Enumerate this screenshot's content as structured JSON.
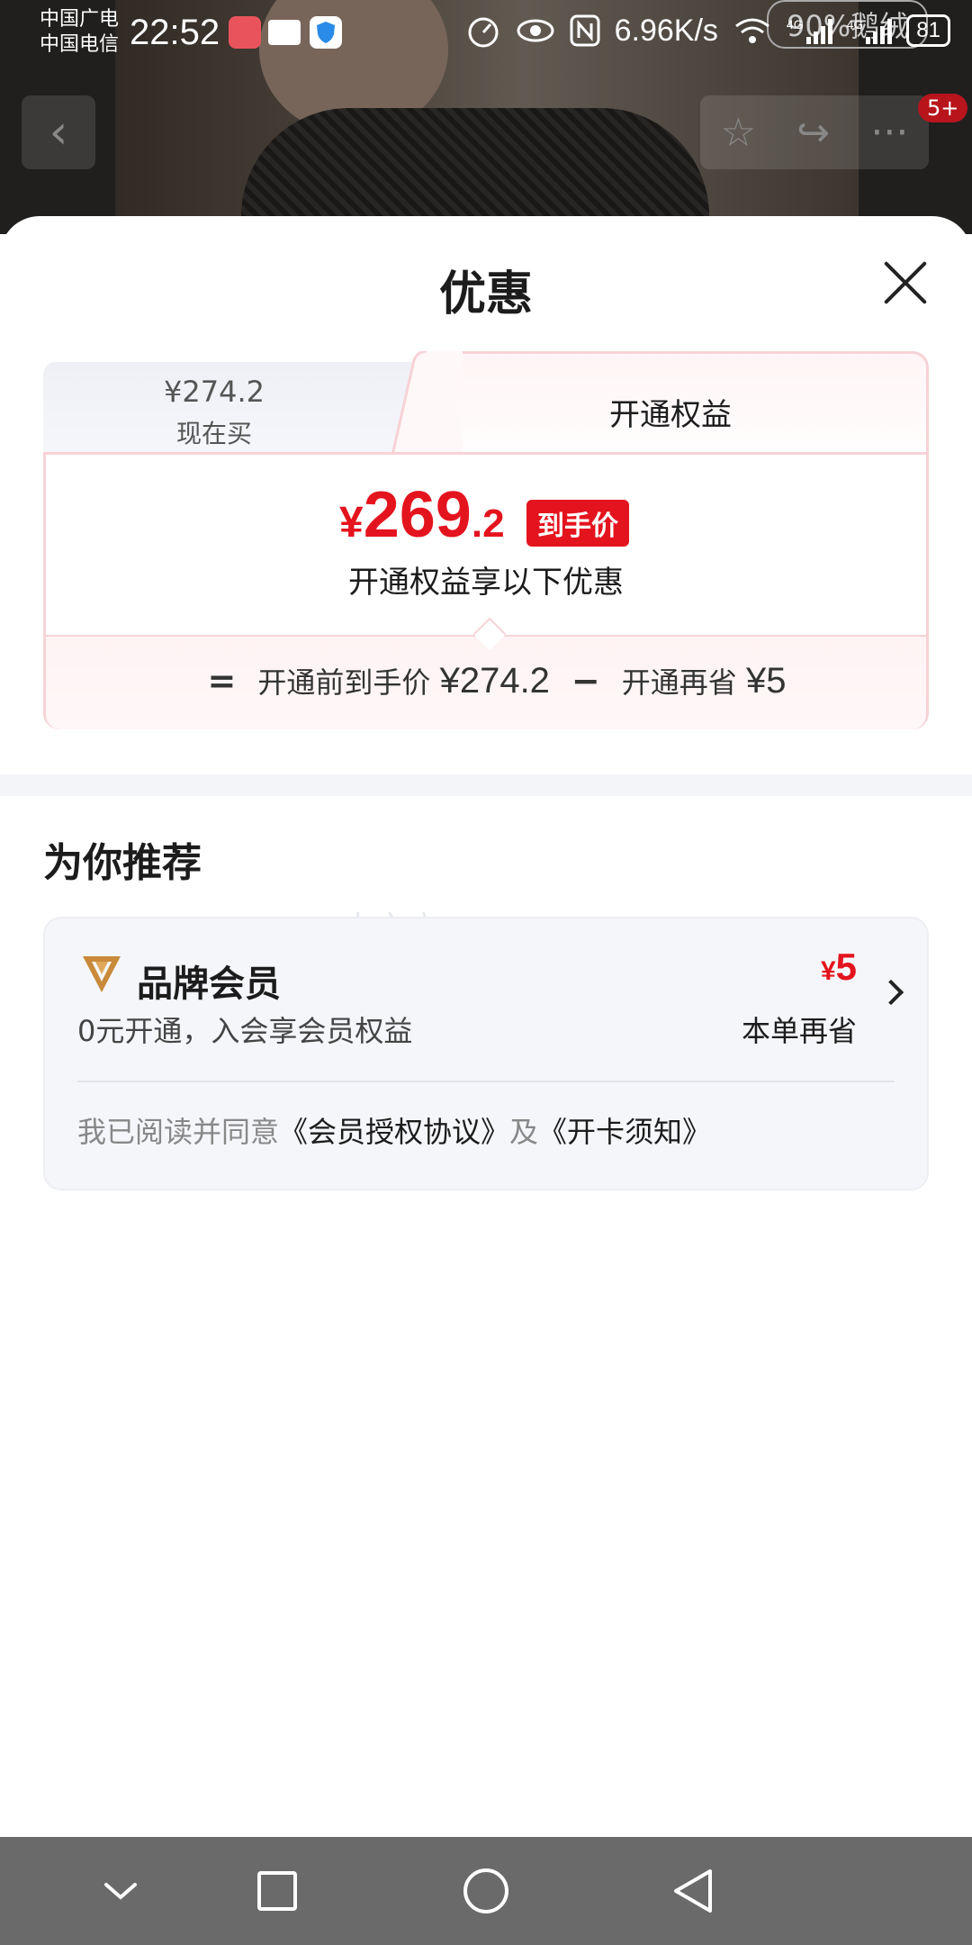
{
  "status_bar": {
    "carrier1": "中国广电",
    "carrier2": "中国电信",
    "time": "22:52",
    "speed": "6.96K/s",
    "network1": "4G",
    "network2": "4G",
    "battery": "81"
  },
  "background": {
    "badge": "5+",
    "tag": "90%鹅绒"
  },
  "sheet": {
    "title": "优惠",
    "tabs": {
      "left_price": "¥274.2",
      "left_label": "现在买",
      "right_label": "开通权益"
    },
    "final_price": {
      "currency": "¥",
      "integer": "269",
      "decimal": ".2",
      "badge": "到手价",
      "desc": "开通权益享以下优惠"
    },
    "formula": {
      "eq": "=",
      "before_label": "开通前到手价",
      "before_value": "¥274.2",
      "minus": "−",
      "save_label": "开通再省",
      "save_value": "¥5"
    }
  },
  "recommend": {
    "title": "为你推荐",
    "watermark": "电之广二",
    "card": {
      "name": "品牌会员",
      "sub": "0元开通，入会享会员权益",
      "save_currency": "¥",
      "save_value": "5",
      "save_label": "本单再省",
      "agree_prefix": "我已阅读并同意",
      "agreement1": "《会员授权协议》",
      "agree_and": "及",
      "agreement2": "《开卡须知》"
    }
  },
  "colors": {
    "accent_red": "#e4141e",
    "brand_gold": "#c98a3a",
    "card_border_pink": "#f7d2d6"
  }
}
